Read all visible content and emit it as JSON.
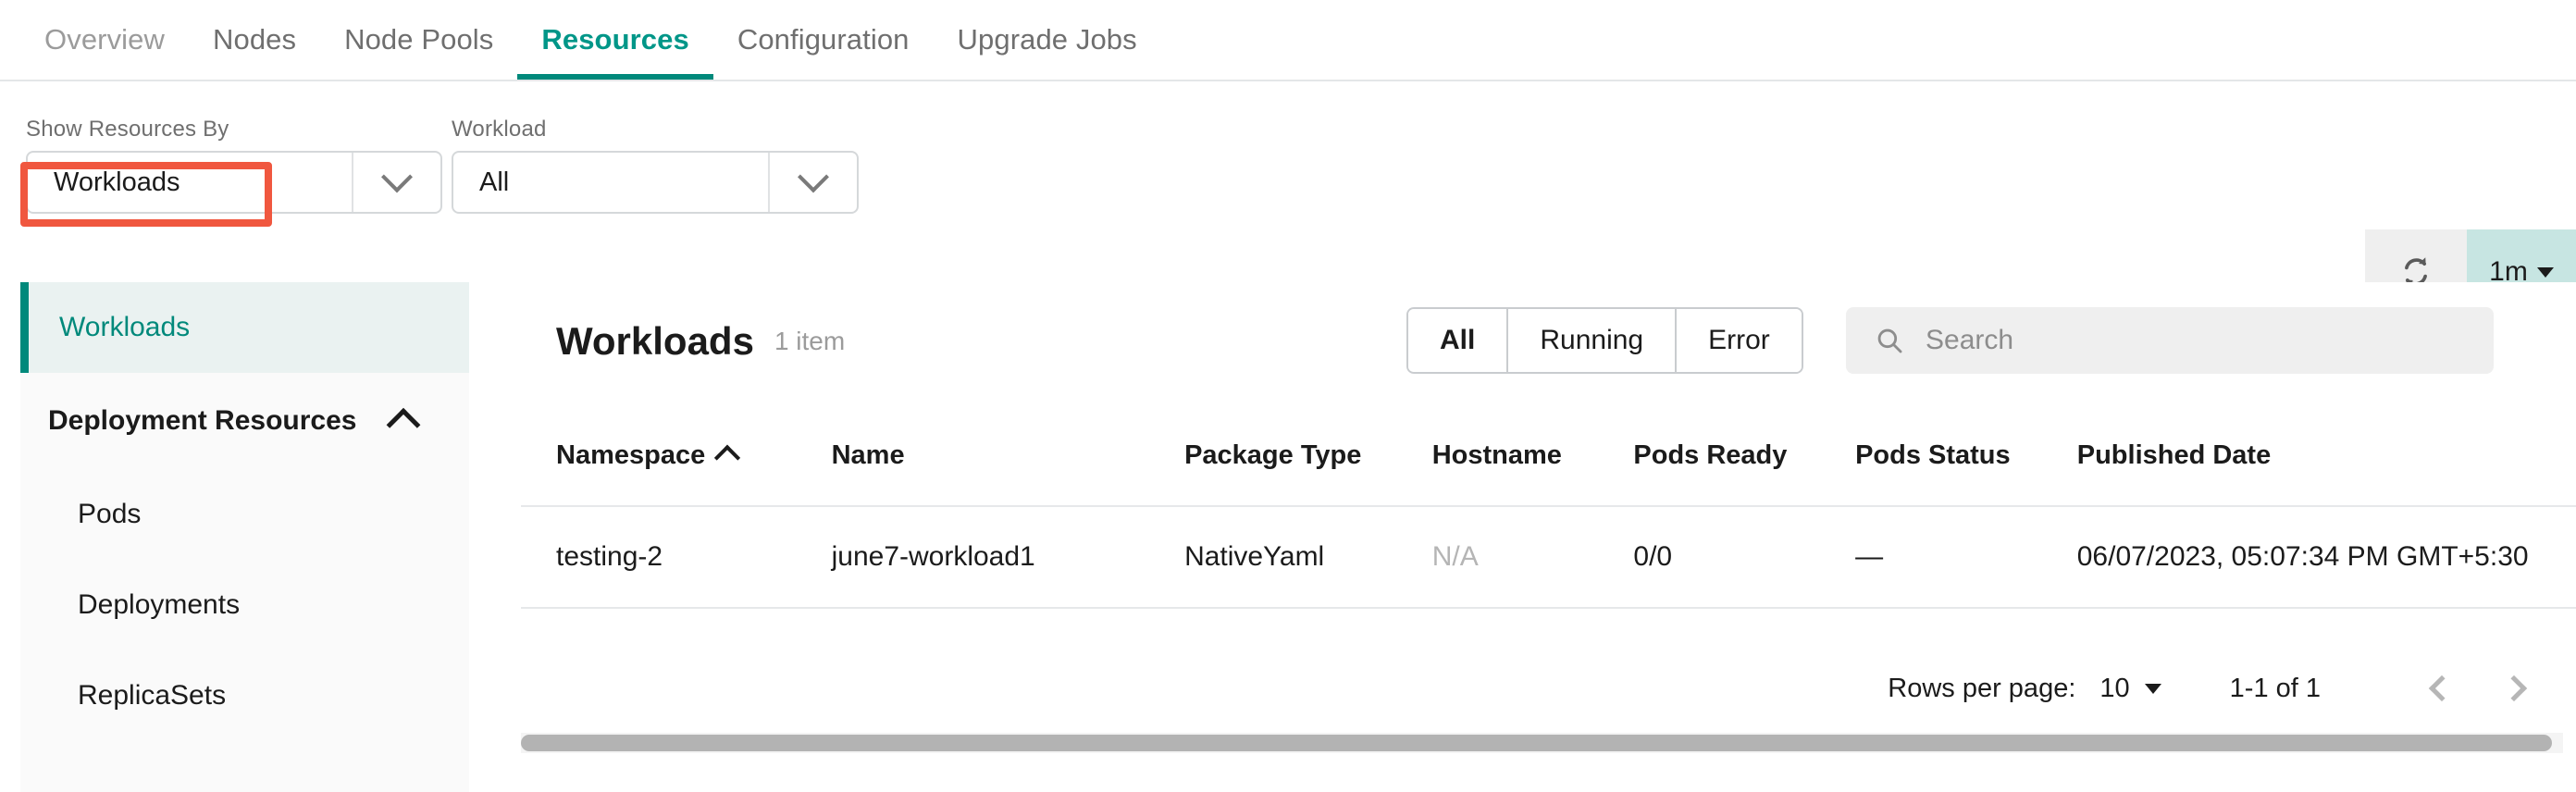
{
  "tabs": [
    {
      "label": "Overview",
      "state": "dim"
    },
    {
      "label": "Nodes",
      "state": "normal"
    },
    {
      "label": "Node Pools",
      "state": "normal"
    },
    {
      "label": "Resources",
      "state": "active"
    },
    {
      "label": "Configuration",
      "state": "normal"
    },
    {
      "label": "Upgrade Jobs",
      "state": "normal"
    }
  ],
  "filters": {
    "show_resources_by": {
      "label": "Show Resources By",
      "value": "Workloads"
    },
    "workload": {
      "label": "Workload",
      "value": "All"
    }
  },
  "refresh": {
    "icon": "refresh-icon",
    "interval": "1m",
    "interval_bg": "#c7e5e2"
  },
  "sidebar": {
    "active_item": "Workloads",
    "group": {
      "label": "Deployment Resources",
      "expanded": true
    },
    "items": [
      "Pods",
      "Deployments",
      "ReplicaSets"
    ]
  },
  "main": {
    "title": "Workloads",
    "count": "1 item",
    "segmented": [
      {
        "label": "All",
        "selected": true
      },
      {
        "label": "Running",
        "selected": false
      },
      {
        "label": "Error",
        "selected": false
      }
    ],
    "search": {
      "placeholder": "Search",
      "value": ""
    }
  },
  "table": {
    "columns": [
      {
        "label": "Namespace",
        "sort": "asc"
      },
      {
        "label": "Name",
        "sort": null
      },
      {
        "label": "Package Type",
        "sort": null
      },
      {
        "label": "Hostname",
        "sort": null
      },
      {
        "label": "Pods Ready",
        "sort": null
      },
      {
        "label": "Pods Status",
        "sort": null
      },
      {
        "label": "Published Date",
        "sort": null
      }
    ],
    "rows": [
      {
        "namespace": "testing-2",
        "name": "june7-workload1",
        "package_type": "NativeYaml",
        "hostname": "N/A",
        "pods_ready": "0/0",
        "pods_status": "—",
        "published_date": "06/07/2023, 05:07:34 PM GMT+5:30"
      }
    ]
  },
  "pagination": {
    "rows_per_page_label": "Rows per page:",
    "rows_per_page_value": "10",
    "range": "1-1 of 1",
    "prev_icon": "chevron-left-icon",
    "next_icon": "chevron-right-icon"
  },
  "colors": {
    "accent": "#00897b",
    "highlight_border": "#f0573f",
    "sidebar_bg": "#fafafa"
  }
}
